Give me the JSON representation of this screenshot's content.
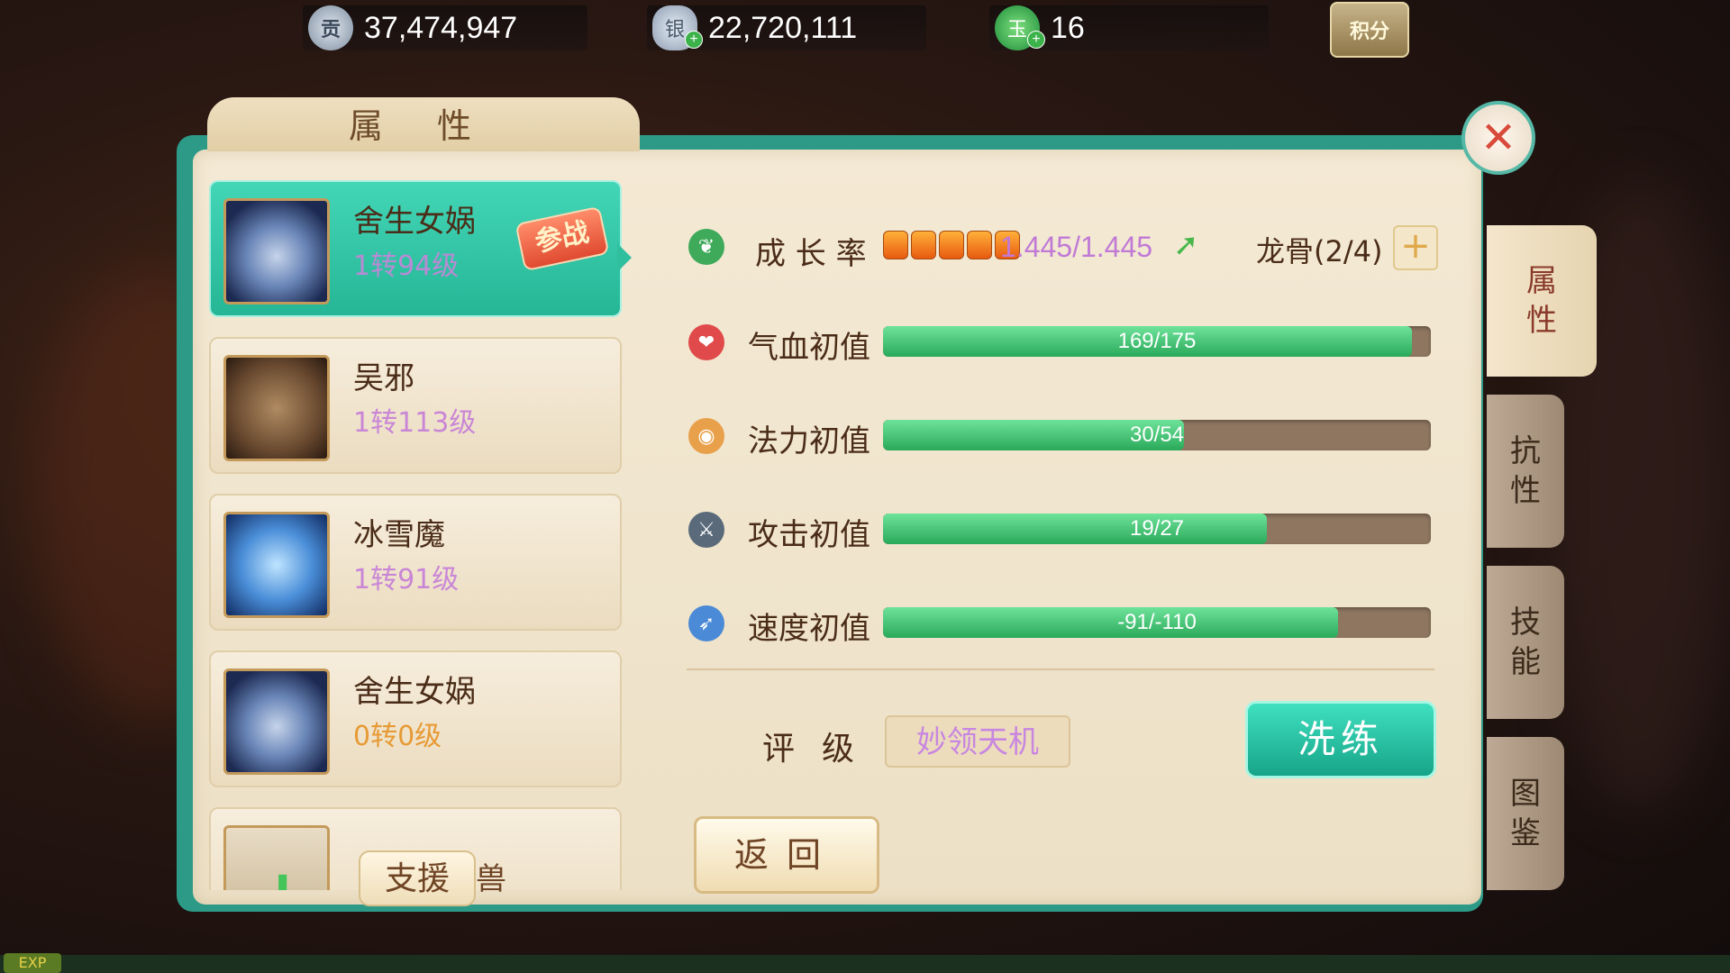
{
  "currency": {
    "gong": "37,474,947",
    "silver": "22,720,111",
    "jade": "16",
    "gong_icon": "gong-coin-icon",
    "silver_icon": "silver-ingot-icon",
    "jade_icon": "jade-gem-icon",
    "jifen": "积分"
  },
  "panel": {
    "title": "属性",
    "close_icon": "close-icon"
  },
  "pets": [
    {
      "name": "舍生女娲",
      "level": "1转94级",
      "badge": "参战",
      "active": true
    },
    {
      "name": "吴邪",
      "level": "1转113级"
    },
    {
      "name": "冰雪魔",
      "level": "1转91级"
    },
    {
      "name": "舍生女娲",
      "level": "0转0级"
    }
  ],
  "support": {
    "button": "支援",
    "suffix": "兽"
  },
  "growth": {
    "label": "成 长 率",
    "pips": 5,
    "value": "1.445/1.445",
    "dragon_bone": "龙骨(2/4)"
  },
  "stats": [
    {
      "label": "气血初值",
      "text": "169/175",
      "fill": 0.965,
      "icon": "heart-icon",
      "color": "#e04a4a"
    },
    {
      "label": "法力初值",
      "text": "30/54",
      "fill": 0.55,
      "icon": "mana-icon",
      "color": "#e8a04a"
    },
    {
      "label": "攻击初值",
      "text": "19/27",
      "fill": 0.7,
      "icon": "sword-icon",
      "color": "#5a6a7a"
    },
    {
      "label": "速度初值",
      "text": "-91/-110",
      "fill": 0.83,
      "icon": "speed-icon",
      "color": "#4a8ad6"
    }
  ],
  "rating": {
    "label": "评级",
    "value": "妙领天机"
  },
  "buttons": {
    "wash": "洗练",
    "back": "返回"
  },
  "side_tabs": [
    "属性",
    "抗性",
    "技能",
    "图鉴"
  ],
  "exp": "EXP"
}
